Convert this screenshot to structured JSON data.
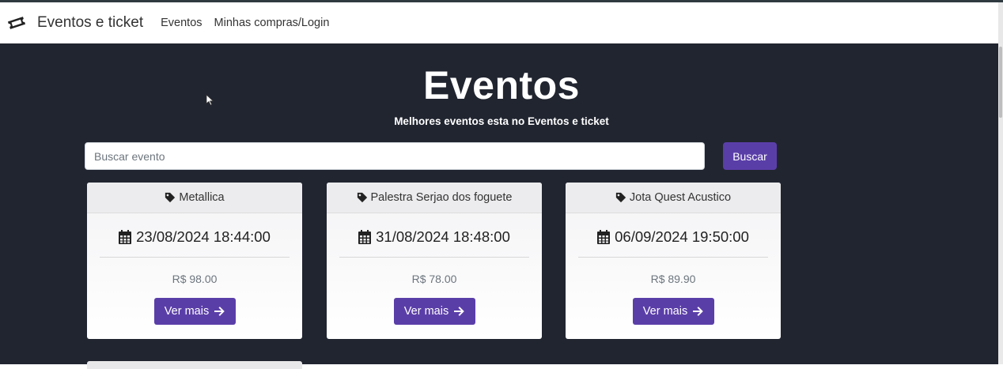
{
  "navbar": {
    "brand_icon": "ticket-icon",
    "brand": "Eventos e ticket",
    "links": [
      "Eventos",
      "Minhas compras/Login"
    ]
  },
  "hero": {
    "title": "Eventos",
    "subtitle": "Melhores eventos esta no Eventos e ticket"
  },
  "search": {
    "placeholder": "Buscar evento",
    "button_label": "Buscar"
  },
  "events": [
    {
      "name": "Metallica",
      "datetime": "23/08/2024 18:44:00",
      "price": "R$ 98.00",
      "button": "Ver mais"
    },
    {
      "name": "Palestra Serjao dos foguete",
      "datetime": "31/08/2024 18:48:00",
      "price": "R$ 78.00",
      "button": "Ver mais"
    },
    {
      "name": "Jota Quest Acustico",
      "datetime": "06/09/2024 19:50:00",
      "price": "R$ 89.90",
      "button": "Ver mais"
    }
  ],
  "colors": {
    "hero_background": "#212530",
    "accent": "#5a3ea8"
  }
}
